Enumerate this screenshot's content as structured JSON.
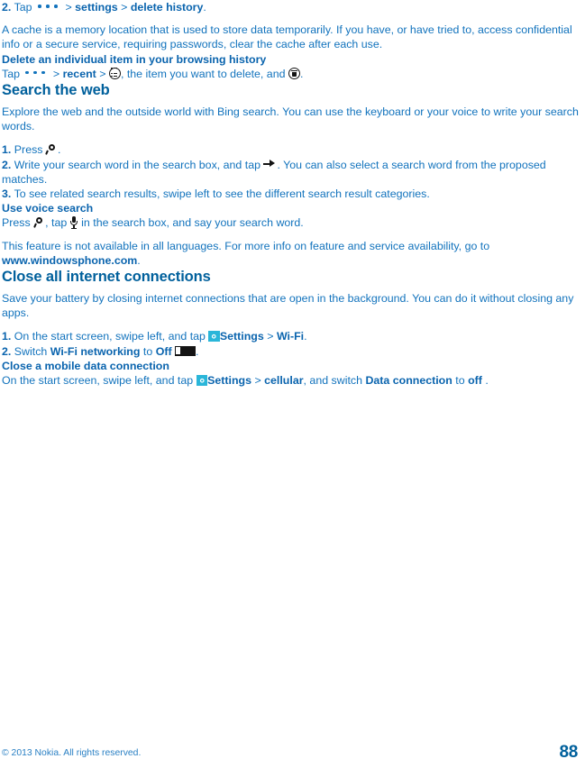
{
  "document": {
    "page_number": "88",
    "copyright": "© 2013 Nokia. All rights reserved."
  },
  "browsing_history": {
    "step2": {
      "number": "2.",
      "text_before_dots": "Tap",
      "sep1": ">",
      "settings": "settings",
      "sep2": ">",
      "delete_history": "delete history",
      "period": "."
    },
    "cache_note": "A cache is a memory location that is used to store data temporarily. If you have, or have tried to, access confidential info or a secure service, requiring passwords, clear the cache after each use.",
    "delete_item_heading": "Delete an individual item in your browsing history",
    "delete_item_steps": {
      "tap": "Tap",
      "sep1": ">",
      "recent": "recent",
      "sep2": ">",
      "after_list_icon": ", the item you want to delete, and",
      "period": "."
    }
  },
  "search_the_web": {
    "title": "Search the web",
    "intro": "Explore the web and the outside world with Bing search. You can use the keyboard or your voice to write your search words.",
    "step1": {
      "number": "1.",
      "text": "Press",
      "period": "."
    },
    "step2": {
      "number": "2.",
      "text_before_arrow": "Write your search word in the search box, and tap",
      "text_after_arrow": ". You can also select a search word from the proposed matches."
    },
    "step3": {
      "number": "3.",
      "text": "To see related search results, swipe left to see the different search result categories."
    },
    "voice_search": {
      "heading": "Use voice search",
      "text_before_search_icon": "Press",
      "text_between": ", tap",
      "text_after_mic": "in the search box, and say your search word."
    },
    "availability_note_start": "This feature is not available in all languages. For more info on feature and service availability, go to",
    "availability_link": "www.windowsphone.com",
    "availability_note_end": "."
  },
  "close_connections": {
    "title": "Close all internet connections",
    "intro": "Save your battery by closing internet connections that are open in the background. You can do it without closing any apps.",
    "step1": {
      "number": "1.",
      "text_before_gear": "On the start screen, swipe left, and tap",
      "settings": "Settings",
      "sep": ">",
      "wifi": "Wi-Fi",
      "period": "."
    },
    "step2": {
      "number": "2.",
      "switch_word": "Switch",
      "wifi_networking": "Wi-Fi networking",
      "to_word": "to",
      "off_word": "Off",
      "period": "."
    },
    "mobile_data": {
      "heading": "Close a mobile data connection",
      "text_before_gear": "On the start screen, swipe left, and tap",
      "settings": "Settings",
      "sep": ">",
      "cellular": "cellular",
      "text_middle": ", and switch",
      "data_connection": "Data connection",
      "to_word": "to",
      "off_word": "off",
      "period": "."
    }
  },
  "colors": {
    "body_text": "#1273bd",
    "heading": "#00609c",
    "bold_text": "#0a64ae",
    "gear_tile": "#2ab6d9",
    "icon_black": "#141414"
  },
  "icons": {
    "dots": "more-dots-icon",
    "circle_list": "circled-list-icon",
    "circle_trash": "circled-delete-icon",
    "search": "search-magnifier-icon",
    "arrow": "right-arrow-icon",
    "mic": "microphone-icon",
    "gear": "settings-gear-icon",
    "toggle": "toggle-switch-off-icon"
  }
}
